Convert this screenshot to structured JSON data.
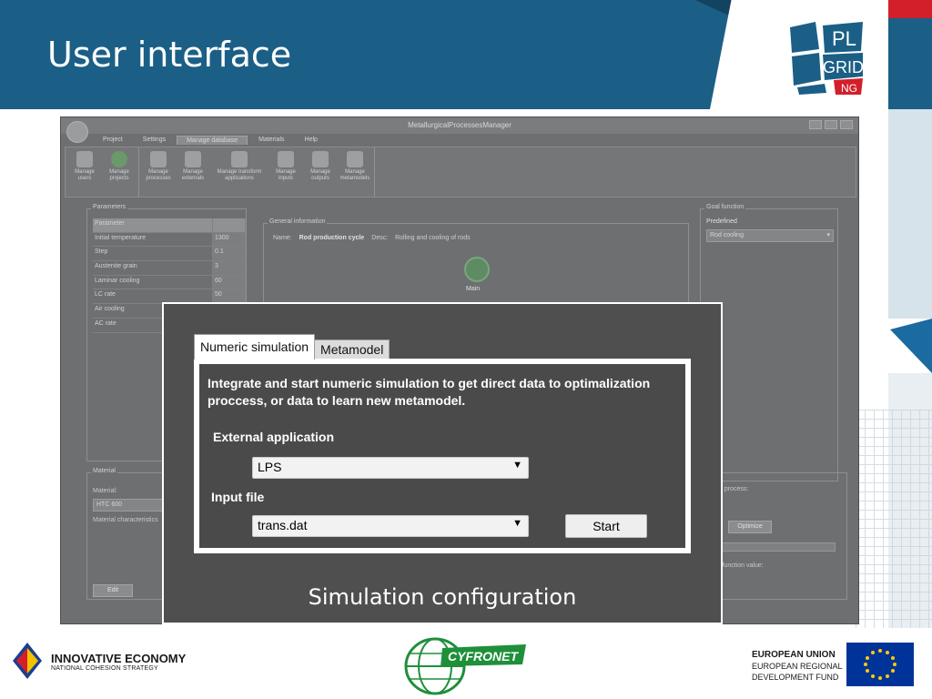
{
  "slide": {
    "title": "User interface",
    "caption": "Simulation configuration"
  },
  "colors": {
    "header_blue": "#1b5f86",
    "header_dark": "#12435f",
    "accent_red": "#d31f2a",
    "overlay_bg": "#4f4f4f"
  },
  "app": {
    "window_title": "MetallurgicalProcessesManager",
    "menu": [
      "Project",
      "Settings",
      "Manage database",
      "Materials",
      "Help"
    ],
    "active_menu": "Manage database",
    "ribbon": {
      "group1": [
        "Manage users",
        "Manage projects"
      ],
      "group2": [
        "Manage processes",
        "Manage externals",
        "Manage transform applications",
        "Manage inputs",
        "Manage outputs",
        "Manage metamodels"
      ]
    },
    "parameters": {
      "legend": "Parameters",
      "header": "Parameter",
      "rows": [
        {
          "name": "Initial temperature",
          "value": "1300"
        },
        {
          "name": "Step",
          "value": "0.1"
        },
        {
          "name": "Austenite grain",
          "value": "3"
        },
        {
          "name": "Laminar cooling",
          "value": "60"
        },
        {
          "name": "LC rate",
          "value": "50"
        },
        {
          "name": "Air cooling",
          "value": ""
        },
        {
          "name": "AC rate",
          "value": ""
        }
      ]
    },
    "general": {
      "legend": "General information",
      "name_label": "Name:",
      "name_value": "Rod production cycle",
      "desc_label": "Desc:",
      "desc_value": "Rolling and cooling of rods",
      "main_node": "Main"
    },
    "goal": {
      "legend": "Goal function",
      "predefined": "Predefined",
      "selected": "Rod cooling"
    },
    "material": {
      "legend": "Material",
      "label": "Material:",
      "value": "HTC 600",
      "characteristics": "Material characteristics",
      "edit": "Edit"
    },
    "optimization": {
      "process_label": "n process:",
      "optimize": "Optimize",
      "goal_value_label": "l function value:"
    }
  },
  "simulation": {
    "tabs": [
      "Numeric simulation",
      "Metamodel"
    ],
    "active_tab": "Numeric simulation",
    "description": "Integrate and start numeric simulation to get direct data to optimalization proccess, or data to learn new metamodel.",
    "external_app_label": "External application",
    "external_app_value": "LPS",
    "input_file_label": "Input file",
    "input_file_value": "trans.dat",
    "start_label": "Start"
  },
  "footer": {
    "ie_title": "INNOVATIVE ECONOMY",
    "ie_sub": "NATIONAL COHESION STRATEGY",
    "cyfronet": "CYFRONET",
    "eu_line1": "EUROPEAN UNION",
    "eu_line2": "EUROPEAN REGIONAL",
    "eu_line3": "DEVELOPMENT FUND",
    "plgrid_line1": "PL",
    "plgrid_line2": "GRID",
    "plgrid_line3": "NG"
  }
}
